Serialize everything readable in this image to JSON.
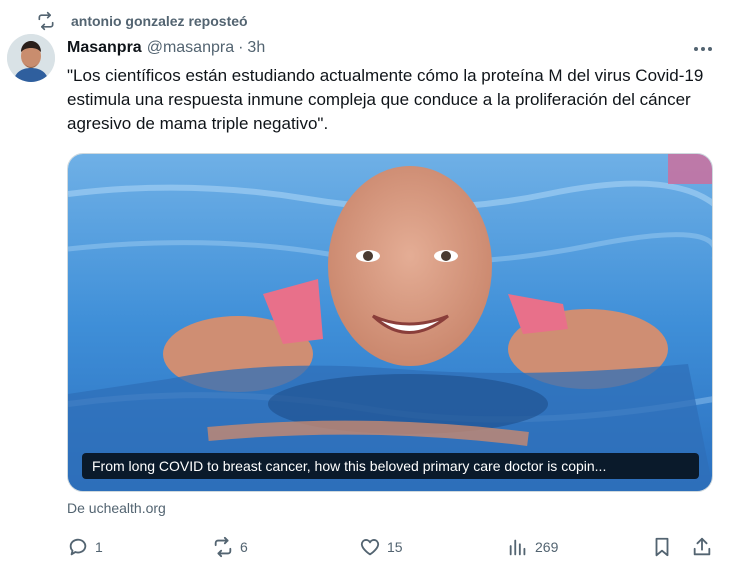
{
  "repost": {
    "text": "antonio gonzalez reposteó",
    "icon": "repost-icon"
  },
  "author": {
    "name": "Masanpra",
    "handle": "@masanpra",
    "separator": "·",
    "time": "3h"
  },
  "tweet": {
    "text": "\"Los científicos están estudiando actualmente cómo la proteína M del virus Covid-19 estimula una respuesta inmune compleja que conduce a la proliferación del cáncer agresivo de mama triple negativo\"."
  },
  "card": {
    "caption": "From long COVID to breast cancer, how this beloved primary care doctor is copin...",
    "source": "De uchealth.org"
  },
  "actions": {
    "replies": "1",
    "reposts": "6",
    "likes": "15",
    "views": "269"
  },
  "colors": {
    "text": "#0f1419",
    "secondary": "#536471",
    "border": "#cfd9de"
  }
}
